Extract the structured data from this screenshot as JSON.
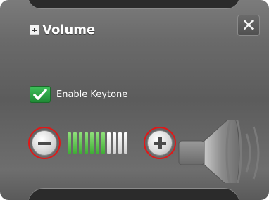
{
  "dialog": {
    "title": "Volume",
    "close_glyph": "✕"
  },
  "keytone": {
    "label": "Enable Keytone",
    "checked": true
  },
  "volume": {
    "minus_icon": "minus-icon",
    "plus_icon": "plus-icon",
    "level": 7,
    "max": 11
  },
  "colors": {
    "accent_green": "#3fae35",
    "highlight_red": "#e01818"
  }
}
